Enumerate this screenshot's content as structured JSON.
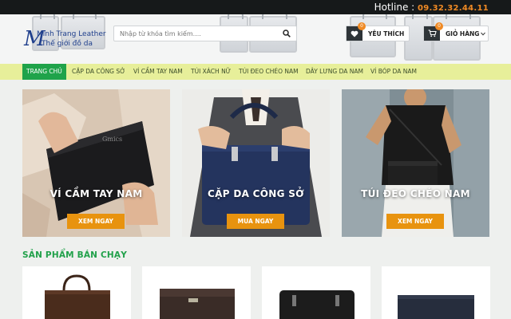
{
  "topbar": {
    "hotline_label": "Hotline :",
    "hotline_number": "09.32.32.44.11"
  },
  "logo": {
    "letter": "M",
    "line1": "Minh Trang Leather",
    "line2": "Thế giới đồ da"
  },
  "search": {
    "placeholder": "Nhập từ khóa tìm kiếm....",
    "icon": "search-icon"
  },
  "wishlist": {
    "label": "YÊU THÍCH",
    "count": "0",
    "icon": "heart-icon"
  },
  "cart": {
    "label": "GIỎ HÀNG",
    "count": "0",
    "icon": "cart-icon"
  },
  "nav": {
    "items": [
      {
        "label": "Trang chủ"
      },
      {
        "label": "Cặp da công sở"
      },
      {
        "label": "Ví cầm tay nam"
      },
      {
        "label": "Túi xách nữ"
      },
      {
        "label": "Túi đeo chéo nam"
      },
      {
        "label": "Dây lưng da nam"
      },
      {
        "label": "Ví bóp da nam"
      }
    ],
    "active_index": 0
  },
  "banners": [
    {
      "title": "VÍ CẦM TAY NAM",
      "button": "XEM NGAY"
    },
    {
      "title": "CẶP DA CÔNG SỞ",
      "button": "MUA NGAY"
    },
    {
      "title": "TÚI ĐEO CHÉO NAM",
      "button": "XEM NGAY"
    }
  ],
  "best_sellers": {
    "title": "SẢN PHẨM BÁN CHẠY"
  },
  "colors": {
    "accent_green": "#1fa34a",
    "cta_orange": "#e8930f",
    "nav_bg": "#e7ef9a",
    "hotline_orange": "#f08a24"
  }
}
